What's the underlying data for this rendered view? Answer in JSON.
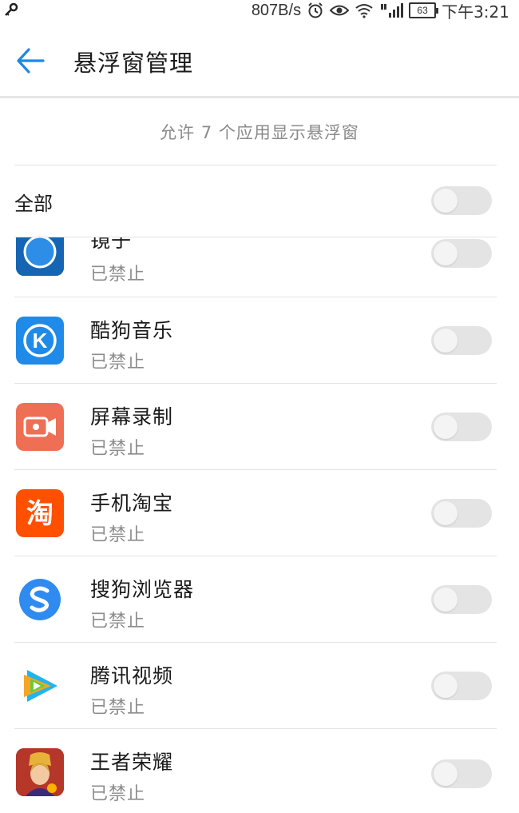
{
  "status_bar": {
    "network_speed": "807B/s",
    "battery_level": "63",
    "time": "下午3:21",
    "icons": [
      "key-icon",
      "alarm-icon",
      "eye-icon",
      "wifi-icon",
      "signal-icon",
      "battery-icon"
    ]
  },
  "header": {
    "title": "悬浮窗管理",
    "back_icon": "arrow-left-icon"
  },
  "summary": "允许 7 个应用显示悬浮窗",
  "all_toggle": {
    "label": "全部",
    "enabled": false
  },
  "apps": [
    {
      "name": "镜子",
      "status": "已禁止",
      "enabled": false,
      "icon": "mirror-icon",
      "color": "#1E78C8"
    },
    {
      "name": "酷狗音乐",
      "status": "已禁止",
      "enabled": false,
      "icon": "kugou-icon",
      "color": "#1F8AE8"
    },
    {
      "name": "屏幕录制",
      "status": "已禁止",
      "enabled": false,
      "icon": "screen-recorder-icon",
      "color": "#EE6F54"
    },
    {
      "name": "手机淘宝",
      "status": "已禁止",
      "enabled": false,
      "icon": "taobao-icon",
      "color": "#FF5000"
    },
    {
      "name": "搜狗浏览器",
      "status": "已禁止",
      "enabled": false,
      "icon": "sogou-browser-icon",
      "color": "#2F8BF0"
    },
    {
      "name": "腾讯视频",
      "status": "已禁止",
      "enabled": false,
      "icon": "tencent-video-icon",
      "color": "#20B4F0"
    },
    {
      "name": "王者荣耀",
      "status": "已禁止",
      "enabled": false,
      "icon": "honor-of-kings-icon",
      "color": "#B4372A"
    }
  ],
  "icon_glyphs": {
    "kugou": "K",
    "taobao": "淘"
  },
  "colors": {
    "accent": "#1E88E5",
    "toggle_off": "#E4E4E4",
    "secondary_text": "#8C8C8C"
  }
}
